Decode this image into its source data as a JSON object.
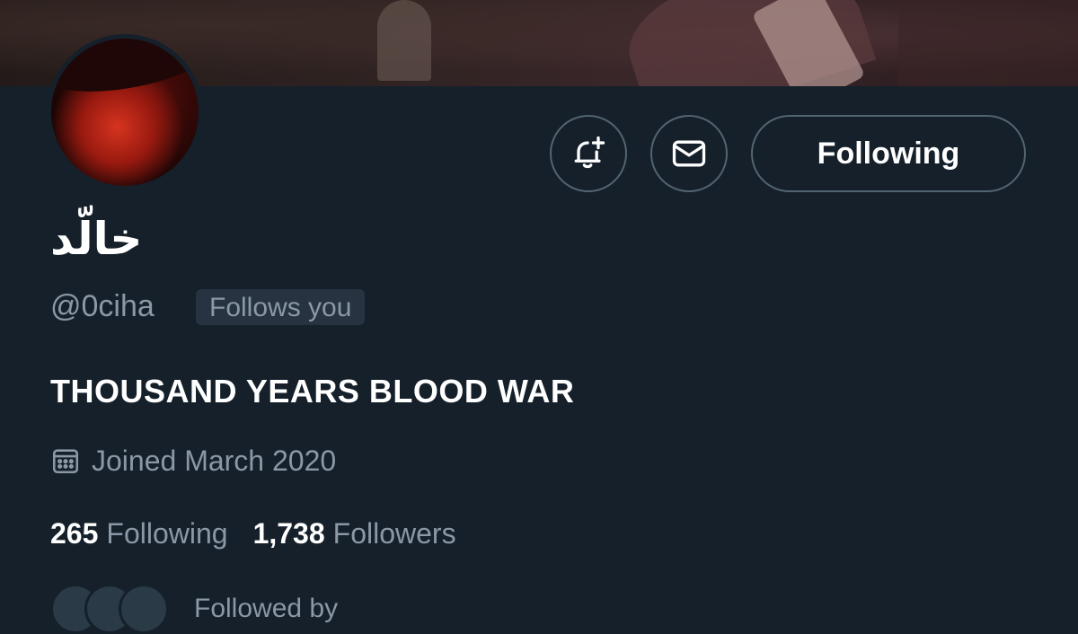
{
  "profile": {
    "display_name": "خالّد",
    "handle": "@0ciha",
    "follows_you_label": "Follows you",
    "bio": "THOUSAND YEARS BLOOD WAR",
    "joined": "Joined March 2020",
    "following_count": "265",
    "following_label": "Following",
    "followers_count": "1,738",
    "followers_label": "Followers",
    "followed_by_text": "Followed by"
  },
  "actions": {
    "follow_button_label": "Following",
    "notify_icon": "bell-plus-icon",
    "message_icon": "envelope-icon"
  },
  "colors": {
    "background": "#15202b",
    "secondary_text": "#8b98a5",
    "border": "#536471"
  }
}
